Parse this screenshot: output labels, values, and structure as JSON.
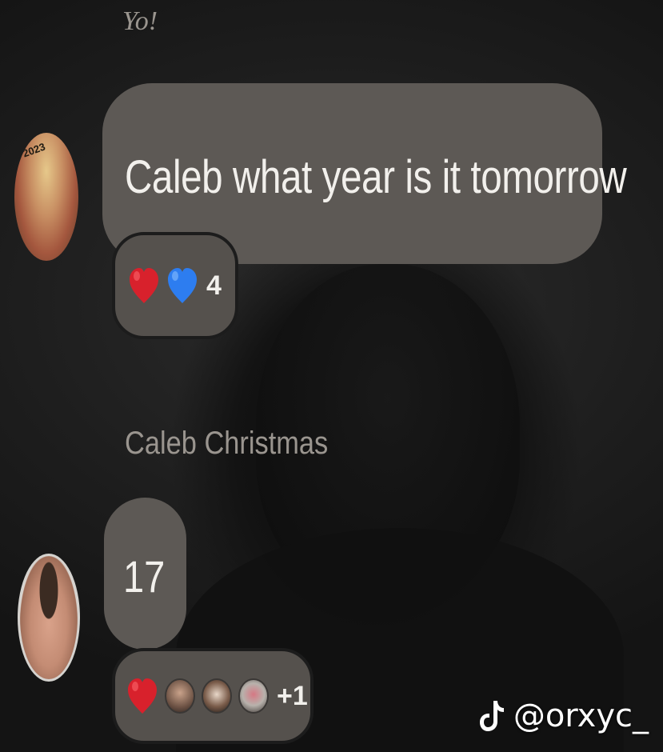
{
  "messages": [
    {
      "sender": "Yo!",
      "text": "Caleb what year is it tomorrow",
      "reactions": {
        "icons": [
          "red-heart-icon",
          "blue-heart-icon"
        ],
        "count": "4"
      }
    },
    {
      "sender": "Caleb Christmas",
      "text": "17",
      "reactions": {
        "icons": [
          "red-heart-icon",
          "reactor-avatar",
          "reactor-avatar",
          "reactor-avatar"
        ],
        "count": "+1"
      }
    }
  ],
  "avatar_1": {
    "badge_text": "2023"
  },
  "watermark": {
    "icon": "tiktok-icon",
    "handle": "@orxyc_"
  },
  "colors": {
    "bubble": "#5d5955",
    "reaction_pill": "#55514d",
    "heart_red": "#d8212c",
    "heart_blue": "#2d7df0",
    "text": "#f2f0ec",
    "sender_name": "#9a958f"
  }
}
